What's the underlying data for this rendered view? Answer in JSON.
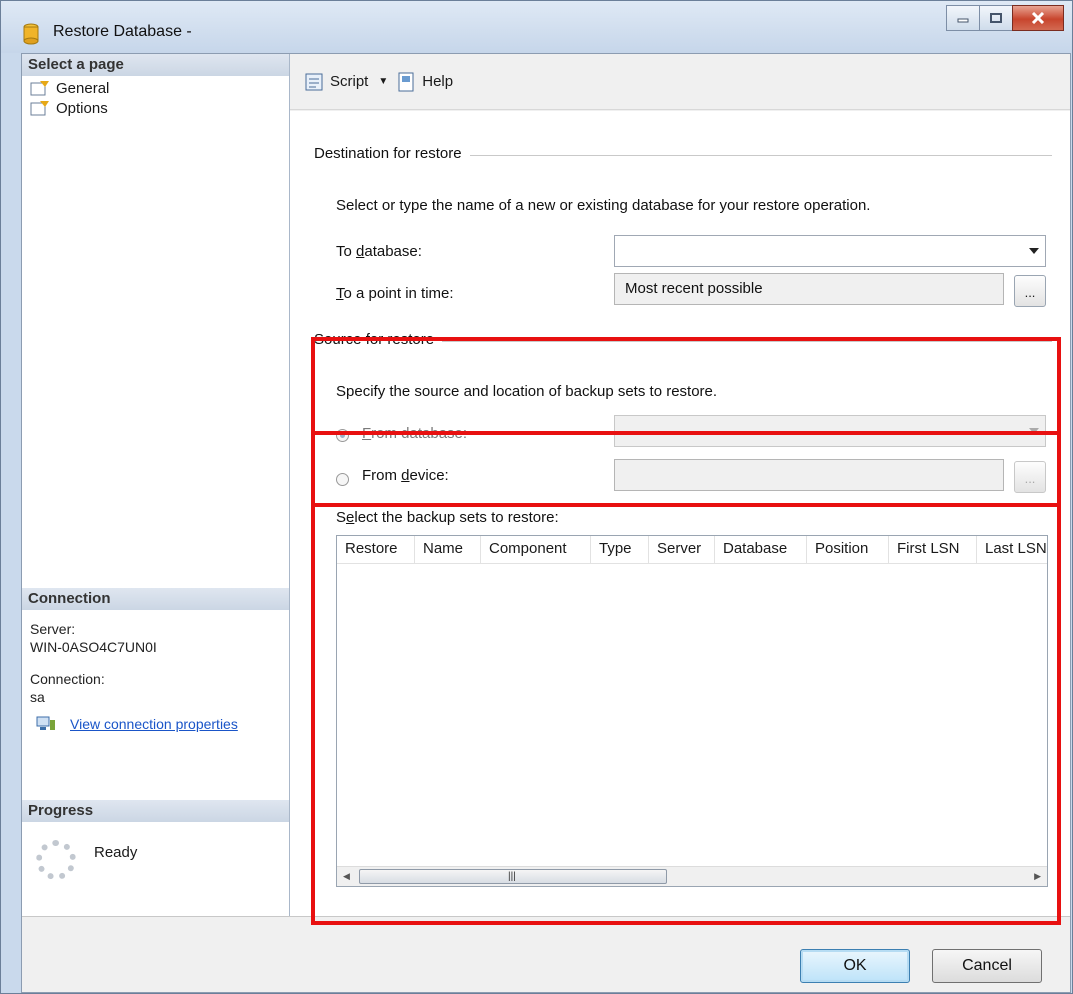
{
  "window": {
    "title": "Restore Database -"
  },
  "left_pane": {
    "select_page_header": "Select a page",
    "pages": [
      {
        "label": "General"
      },
      {
        "label": "Options"
      }
    ],
    "connection_header": "Connection",
    "server_label": "Server:",
    "server_value": "WIN-0ASO4C7UN0I",
    "connection_label": "Connection:",
    "connection_value": "sa",
    "view_connection_link": "View connection properties",
    "progress_header": "Progress",
    "progress_status": "Ready"
  },
  "toolbar": {
    "script_label": "Script",
    "help_label": "Help"
  },
  "destination": {
    "group_title": "Destination for restore",
    "description": "Select or type the name of a new or existing database for your restore operation.",
    "to_database_label": "To database:",
    "to_database_value": "",
    "to_point_in_time_label": "To a point in time:",
    "to_point_in_time_value": "Most recent possible"
  },
  "source": {
    "group_title": "Source for restore",
    "description": "Specify the source and location of backup sets to restore.",
    "from_database_label": "From database:",
    "from_device_label": "From device:",
    "selected_option": "From database",
    "backup_sets_label": "Select the backup sets to restore:",
    "columns": [
      "Restore",
      "Name",
      "Component",
      "Type",
      "Server",
      "Database",
      "Position",
      "First LSN",
      "Last LSN"
    ]
  },
  "buttons": {
    "ok_label": "OK",
    "cancel_label": "Cancel"
  },
  "colors": {
    "annotation_red": "#e81010",
    "link_blue": "#1a55c8"
  }
}
